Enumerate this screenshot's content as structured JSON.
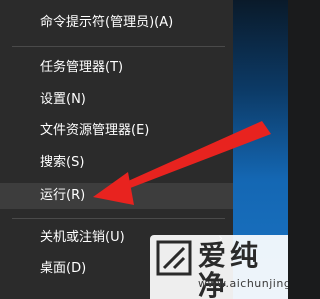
{
  "menu": {
    "items": [
      {
        "label": "命令提示符(管理员)(A)"
      },
      {
        "label": "任务管理器(T)"
      },
      {
        "label": "设置(N)"
      },
      {
        "label": "文件资源管理器(E)"
      },
      {
        "label": "搜索(S)"
      },
      {
        "label": "运行(R)"
      },
      {
        "label": "关机或注销(U)"
      },
      {
        "label": "桌面(D)"
      }
    ],
    "submenu_arrow": "›"
  },
  "watermark": {
    "brand_text": "爱纯净",
    "url": "www.aichunjing.com"
  },
  "colors": {
    "menu_bg": "#2b2b2b",
    "highlight_bg": "#3d3d3d",
    "annotation_arrow": "#e8231f"
  },
  "icons": {
    "annotation": "red-arrow-icon",
    "logo": "aichunjing-logo-icon"
  }
}
